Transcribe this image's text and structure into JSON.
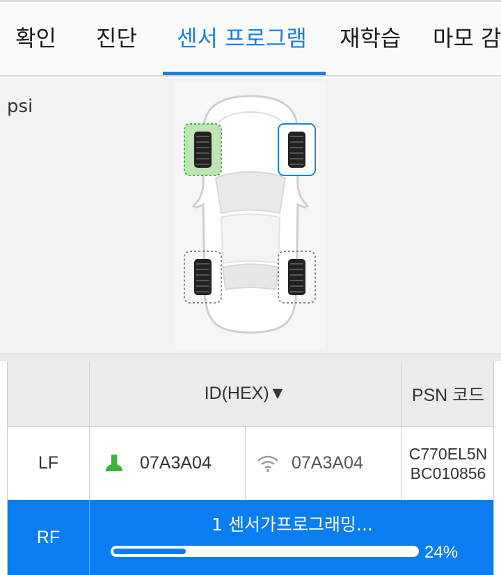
{
  "tabs": [
    {
      "label": "확인"
    },
    {
      "label": "진단"
    },
    {
      "label": "센서 프로그램",
      "active": true
    },
    {
      "label": "재학습"
    },
    {
      "label": "마모 감"
    }
  ],
  "car_panel": {
    "unit": "psi",
    "wheels": {
      "LF": {
        "state": "done",
        "color": "#3bb33b"
      },
      "RF": {
        "state": "selected",
        "color": "#1a7fe6"
      },
      "LR": {
        "state": "idle",
        "color": "#888888"
      },
      "RR": {
        "state": "idle",
        "color": "#888888"
      }
    }
  },
  "table": {
    "header": {
      "id": "ID(HEX)▼",
      "psn": "PSN 코드"
    },
    "rows": [
      {
        "position": "LF",
        "sensor_id": "07A3A04",
        "wireless_id": "07A3A04",
        "psn_line1": "C770EL5N",
        "psn_line2": "BC010856"
      },
      {
        "position": "RF",
        "status": "1 센서가프로그래밍...",
        "progress_percent": 24,
        "progress_label": "24%"
      }
    ]
  },
  "colors": {
    "accent": "#1a7fe6",
    "selected_row": "#0a7ef0",
    "ok_green": "#3bb33b"
  }
}
